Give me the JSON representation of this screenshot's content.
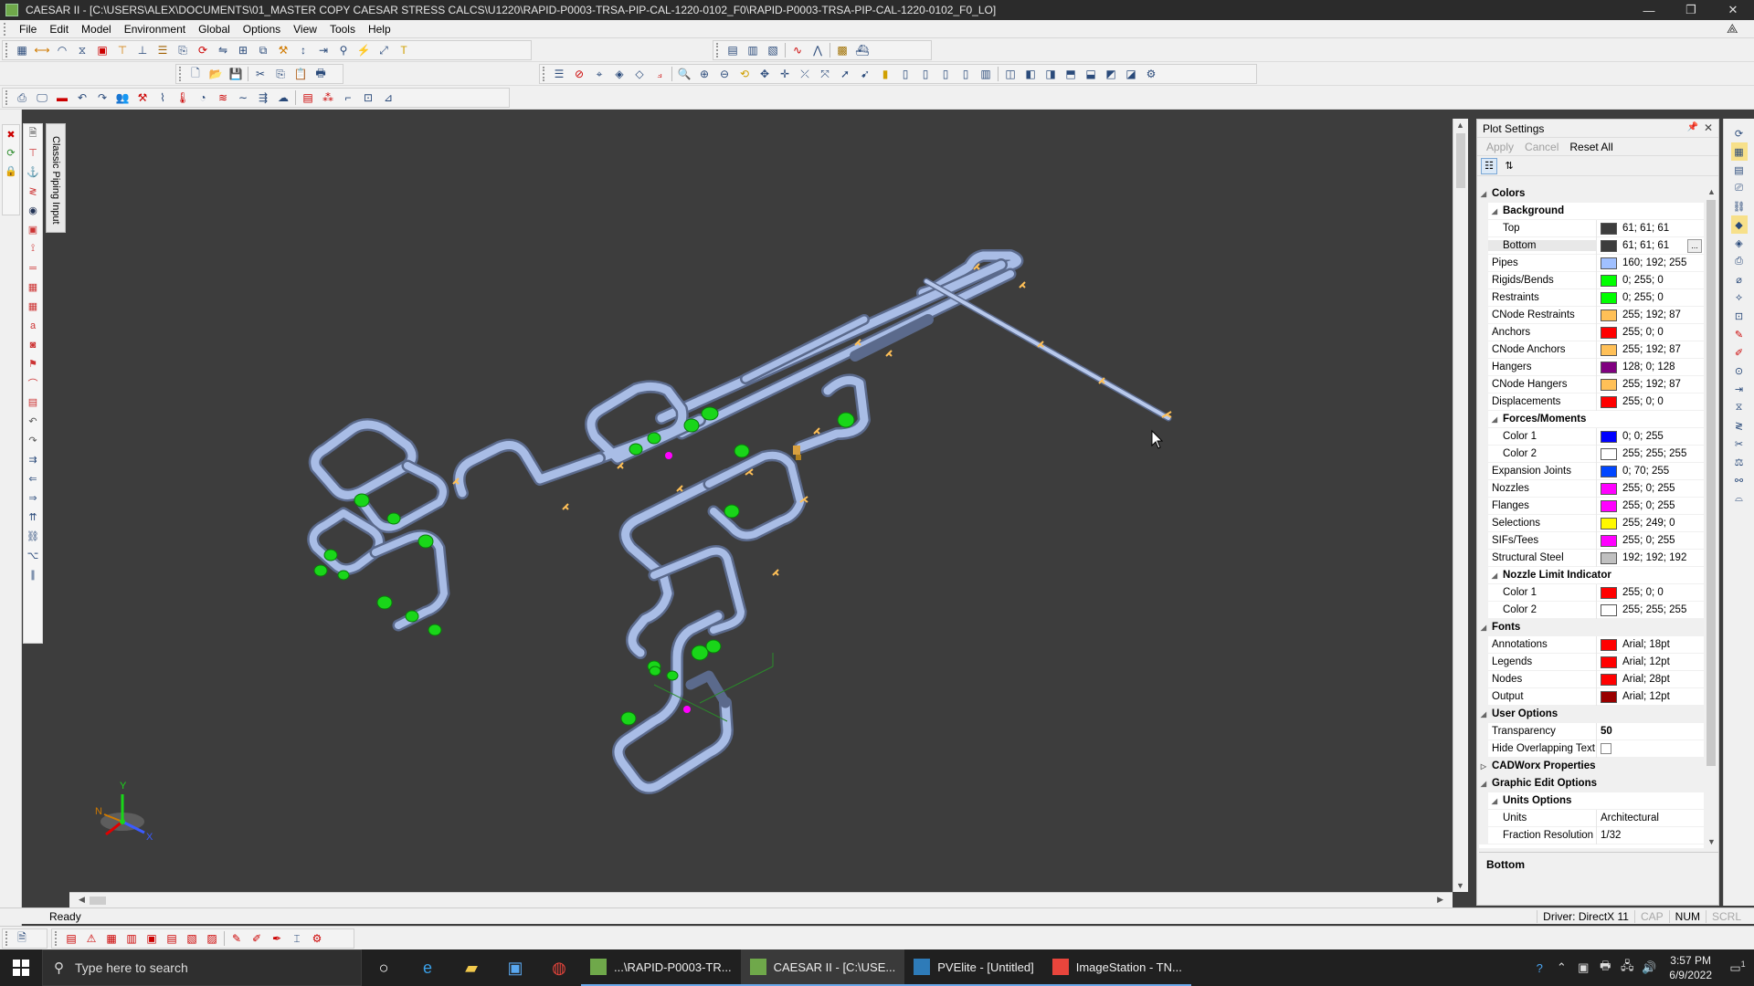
{
  "window": {
    "title": "CAESAR II - [C:\\USERS\\ALEX\\DOCUMENTS\\01_MASTER COPY CAESAR STRESS CALCS\\U1220\\RAPID-P0003-TRSA-PIP-CAL-1220-0102_F0\\RAPID-P0003-TRSA-PIP-CAL-1220-0102_F0_LO]",
    "minimize": "—",
    "restore": "❐",
    "close": "✕"
  },
  "menu": [
    "File",
    "Edit",
    "Model",
    "Environment",
    "Global",
    "Options",
    "View",
    "Tools",
    "Help"
  ],
  "left_tab": {
    "label": "Classic Piping Input"
  },
  "plot_settings": {
    "title": "Plot Settings",
    "pin_icon": "pin-icon",
    "actions": {
      "apply": "Apply",
      "cancel": "Cancel",
      "reset_all": "Reset All"
    },
    "rows": [
      {
        "kind": "cat",
        "name": "Colors"
      },
      {
        "kind": "subcat",
        "name": "Background"
      },
      {
        "kind": "color",
        "name": "Top",
        "indent": true,
        "value": "61; 61; 61",
        "color": "#3d3d3d"
      },
      {
        "kind": "color",
        "name": "Bottom",
        "indent": true,
        "value": "61; 61; 61",
        "color": "#3d3d3d",
        "selected": true,
        "ellipsis": "..."
      },
      {
        "kind": "color",
        "name": "Pipes",
        "value": "160; 192; 255",
        "color": "#a0c0ff"
      },
      {
        "kind": "color",
        "name": "Rigids/Bends",
        "value": "0; 255; 0",
        "color": "#00ff00"
      },
      {
        "kind": "color",
        "name": "Restraints",
        "value": "0; 255; 0",
        "color": "#00ff00"
      },
      {
        "kind": "color",
        "name": "CNode Restraints",
        "value": "255; 192; 87",
        "color": "#ffc057"
      },
      {
        "kind": "color",
        "name": "Anchors",
        "value": "255; 0; 0",
        "color": "#ff0000"
      },
      {
        "kind": "color",
        "name": "CNode Anchors",
        "value": "255; 192; 87",
        "color": "#ffc057"
      },
      {
        "kind": "color",
        "name": "Hangers",
        "value": "128; 0; 128",
        "color": "#800080"
      },
      {
        "kind": "color",
        "name": "CNode Hangers",
        "value": "255; 192; 87",
        "color": "#ffc057"
      },
      {
        "kind": "color",
        "name": "Displacements",
        "value": "255; 0; 0",
        "color": "#ff0000"
      },
      {
        "kind": "subcat",
        "name": "Forces/Moments"
      },
      {
        "kind": "color",
        "name": "Color 1",
        "indent": true,
        "value": "0; 0; 255",
        "color": "#0000ff"
      },
      {
        "kind": "color",
        "name": "Color 2",
        "indent": true,
        "value": "255; 255; 255",
        "color": "#ffffff"
      },
      {
        "kind": "color",
        "name": "Expansion Joints",
        "value": "0; 70; 255",
        "color": "#0046ff"
      },
      {
        "kind": "color",
        "name": "Nozzles",
        "value": "255; 0; 255",
        "color": "#ff00ff"
      },
      {
        "kind": "color",
        "name": "Flanges",
        "value": "255; 0; 255",
        "color": "#ff00ff"
      },
      {
        "kind": "color",
        "name": "Selections",
        "value": "255; 249; 0",
        "color": "#fff900"
      },
      {
        "kind": "color",
        "name": "SIFs/Tees",
        "value": "255; 0; 255",
        "color": "#ff00ff"
      },
      {
        "kind": "color",
        "name": "Structural Steel",
        "value": "192; 192; 192",
        "color": "#c0c0c0"
      },
      {
        "kind": "subcat",
        "name": "Nozzle Limit Indicator"
      },
      {
        "kind": "color",
        "name": "Color 1",
        "indent": true,
        "value": "255; 0; 0",
        "color": "#ff0000"
      },
      {
        "kind": "color",
        "name": "Color 2",
        "indent": true,
        "value": "255; 255; 255",
        "color": "#ffffff"
      },
      {
        "kind": "cat",
        "name": "Fonts"
      },
      {
        "kind": "color",
        "name": "Annotations",
        "value": "Arial; 18pt",
        "color": "#ff0000"
      },
      {
        "kind": "color",
        "name": "Legends",
        "value": "Arial; 12pt",
        "color": "#ff0000"
      },
      {
        "kind": "color",
        "name": "Nodes",
        "value": "Arial; 28pt",
        "color": "#ff0000"
      },
      {
        "kind": "color",
        "name": "Output",
        "value": "Arial; 12pt",
        "color": "#990000"
      },
      {
        "kind": "cat",
        "name": "User Options"
      },
      {
        "kind": "text",
        "name": "Transparency",
        "value": "50",
        "bold": true
      },
      {
        "kind": "check",
        "name": "Hide Overlapping Text",
        "checked": false
      },
      {
        "kind": "cat",
        "name": "CADWorx Properties",
        "collapsed": true
      },
      {
        "kind": "cat",
        "name": "Graphic Edit Options"
      },
      {
        "kind": "subcat",
        "name": "Units Options"
      },
      {
        "kind": "text",
        "name": "Units",
        "indent": true,
        "value": "Architectural"
      },
      {
        "kind": "text",
        "name": "Fraction Resolution",
        "indent": true,
        "value": "1/32"
      }
    ],
    "description": "Bottom"
  },
  "axis_triad": {
    "x": "X",
    "y": "Y",
    "n": "N"
  },
  "status": {
    "ready": "Ready",
    "driver": "Driver: DirectX 11",
    "cap": "CAP",
    "num": "NUM",
    "scrl": "SCRL"
  },
  "taskbar": {
    "search_placeholder": "Type here to search",
    "apps": [
      {
        "label": "...\\RAPID-P0003-TR...",
        "color": "#6fa84a",
        "active": false
      },
      {
        "label": "CAESAR II - [C:\\USE...",
        "color": "#6fa84a",
        "active": true
      },
      {
        "label": "PVElite - [Untitled]",
        "color": "#2e7bb8",
        "active": false
      },
      {
        "label": "ImageStation - TN...",
        "color": "#e8453c",
        "active": false
      }
    ],
    "time": "3:57 PM",
    "date": "6/9/2022",
    "notification_count": "1"
  },
  "colors": {
    "background": "#3d3d3d",
    "pipe": "#a0c0ff",
    "rigid": "#00ff00",
    "restraint": "#ffc057"
  }
}
